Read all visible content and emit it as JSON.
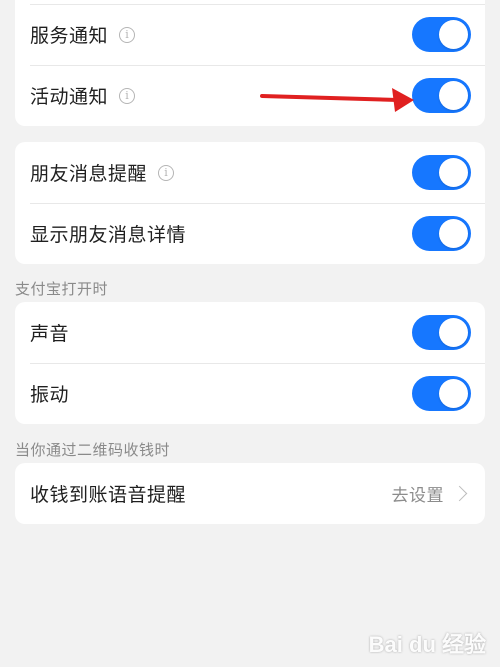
{
  "colors": {
    "toggle_on": "#1677ff",
    "annotation_arrow": "#e02020"
  },
  "card1": {
    "rows": [
      {
        "label": "服务通知",
        "info": "i",
        "toggle": true
      },
      {
        "label": "活动通知",
        "info": "i",
        "toggle": true
      }
    ]
  },
  "card2": {
    "rows": [
      {
        "label": "朋友消息提醒",
        "info": "i",
        "toggle": true
      },
      {
        "label": "显示朋友消息详情",
        "toggle": true
      }
    ]
  },
  "section_alipay_open": "支付宝打开时",
  "card3": {
    "rows": [
      {
        "label": "声音",
        "toggle": true
      },
      {
        "label": "振动",
        "toggle": true
      }
    ]
  },
  "section_qr": "当你通过二维码收钱时",
  "card4": {
    "rows": [
      {
        "label": "收钱到账语音提醒",
        "value": "去设置"
      }
    ]
  },
  "watermark": "Bai du 经验"
}
